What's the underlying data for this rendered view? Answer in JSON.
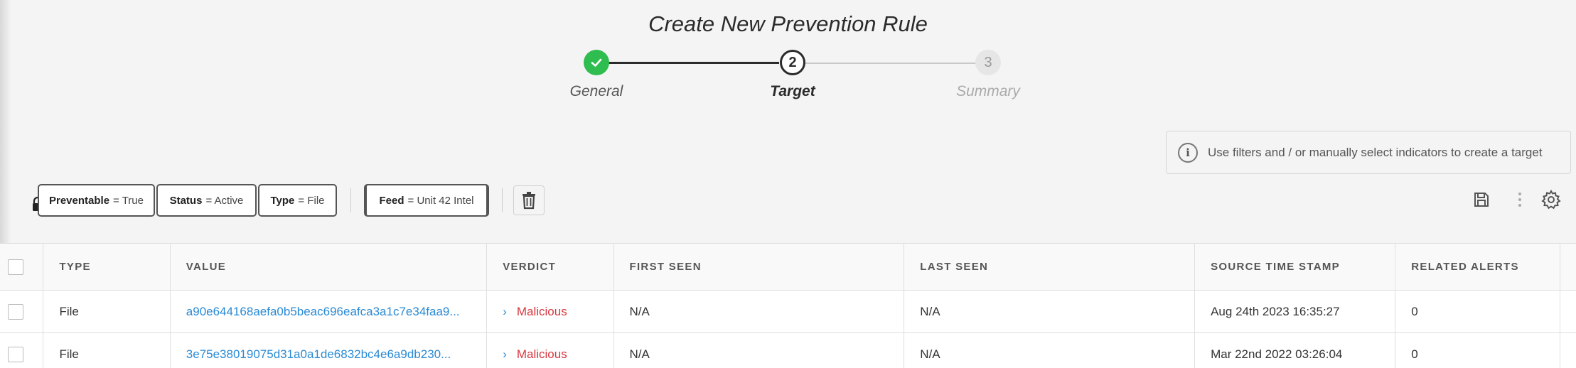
{
  "title": "Create New Prevention Rule",
  "stepper": {
    "steps": [
      {
        "number": "1",
        "label": "General",
        "state": "complete"
      },
      {
        "number": "2",
        "label": "Target",
        "state": "active"
      },
      {
        "number": "3",
        "label": "Summary",
        "state": "pending"
      }
    ]
  },
  "info": {
    "text": "Use filters and / or manually select indicators to create a target",
    "icon": "info-icon"
  },
  "filters": [
    {
      "key": "Preventable",
      "value": "= True",
      "locked": true
    },
    {
      "key": "Status",
      "value": "= Active"
    },
    {
      "key": "Type",
      "value": "= File"
    },
    {
      "key": "Feed",
      "value": "= Unit 42 Intel"
    }
  ],
  "toolbar": {
    "delete_icon": "trash-icon",
    "save_icon": "save-icon",
    "more_icon": "more-vertical-icon",
    "settings_icon": "gear-icon"
  },
  "table": {
    "columns": [
      "TYPE",
      "VALUE",
      "VERDICT",
      "FIRST SEEN",
      "LAST SEEN",
      "SOURCE TIME STAMP",
      "RELATED ALERTS"
    ],
    "rows": [
      {
        "type": "File",
        "value": "a90e644168aefa0b5beac696eafca3a1c7e34faa9...",
        "verdict": "Malicious",
        "first_seen": "N/A",
        "last_seen": "N/A",
        "source_time_stamp": "Aug 24th 2023 16:35:27",
        "related_alerts": "0"
      },
      {
        "type": "File",
        "value": "3e75e38019075d31a0a1de6832bc4e6a9db230...",
        "verdict": "Malicious",
        "first_seen": "N/A",
        "last_seen": "N/A",
        "source_time_stamp": "Mar 22nd 2022 03:26:04",
        "related_alerts": "0"
      }
    ]
  },
  "colors": {
    "complete": "#2ebd4e",
    "link": "#2a8ad4",
    "malicious": "#d8373f"
  }
}
